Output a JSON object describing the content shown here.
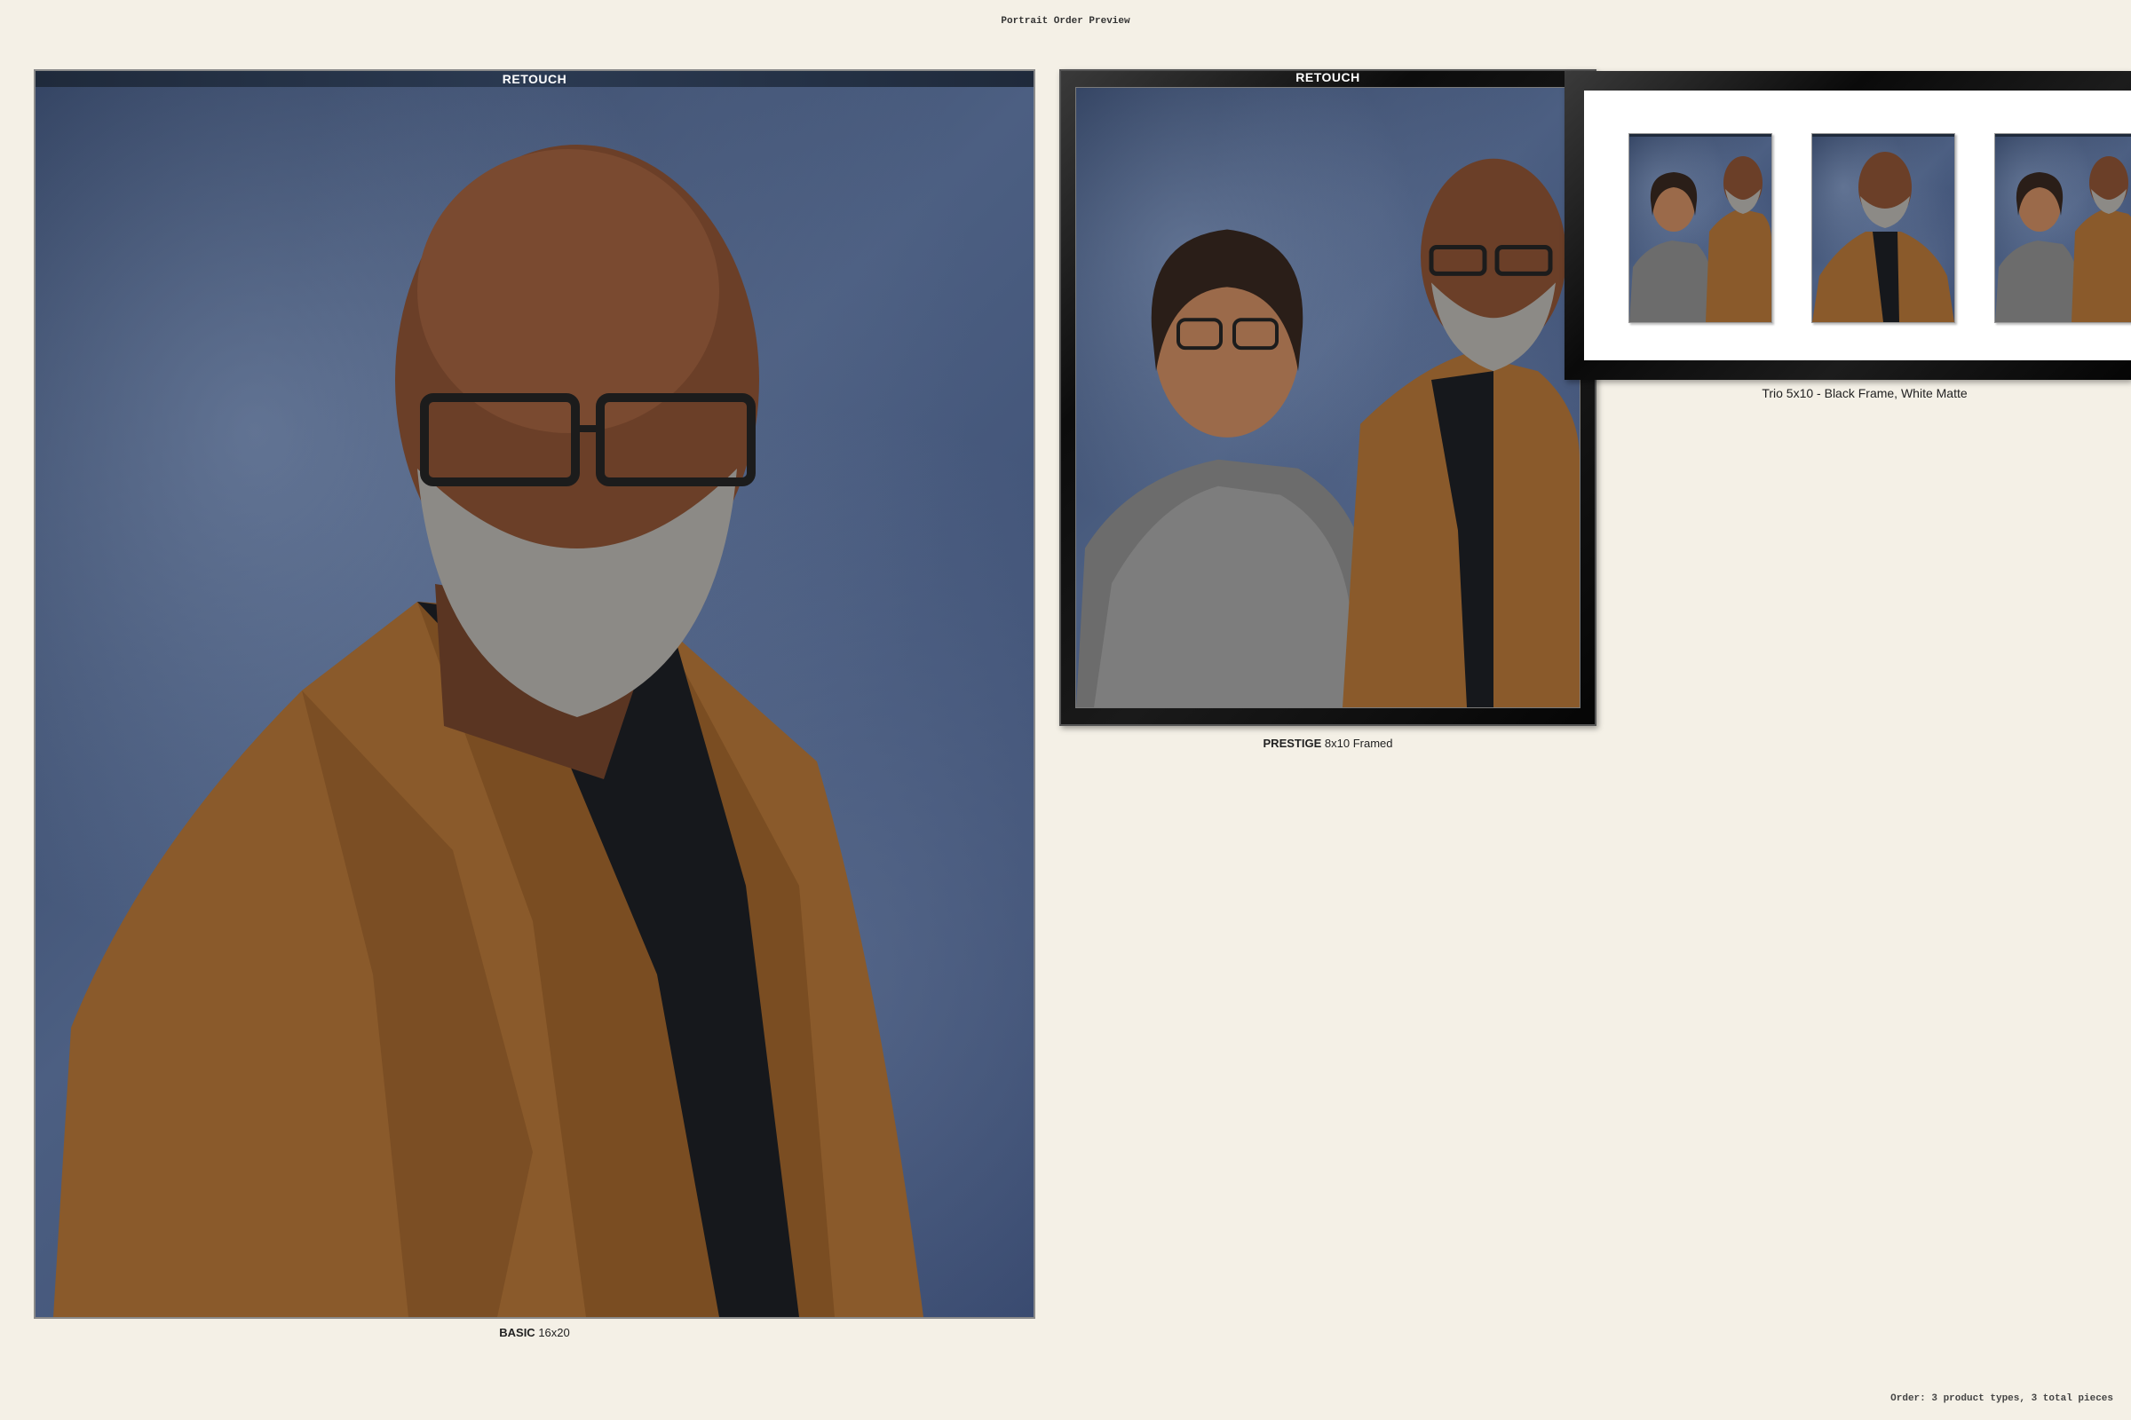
{
  "page": {
    "title": "Portrait Order Preview",
    "footer": "Order: 3 product types, 3 total pieces"
  },
  "products": {
    "basic": {
      "badge": "RETOUCH",
      "tier": "BASIC",
      "size": "16x20"
    },
    "prestige": {
      "badge": "RETOUCH",
      "tier": "PRESTIGE",
      "size": "8x10 Framed"
    },
    "trio": {
      "caption": "Trio 5x10 - Black Frame, White Matte"
    }
  },
  "colors": {
    "page_background": "#f4f0e6",
    "backdrop_blue": "#3f5275",
    "frame_black": "#0c0c0c",
    "jacket_brown": "#8a5a2b"
  }
}
